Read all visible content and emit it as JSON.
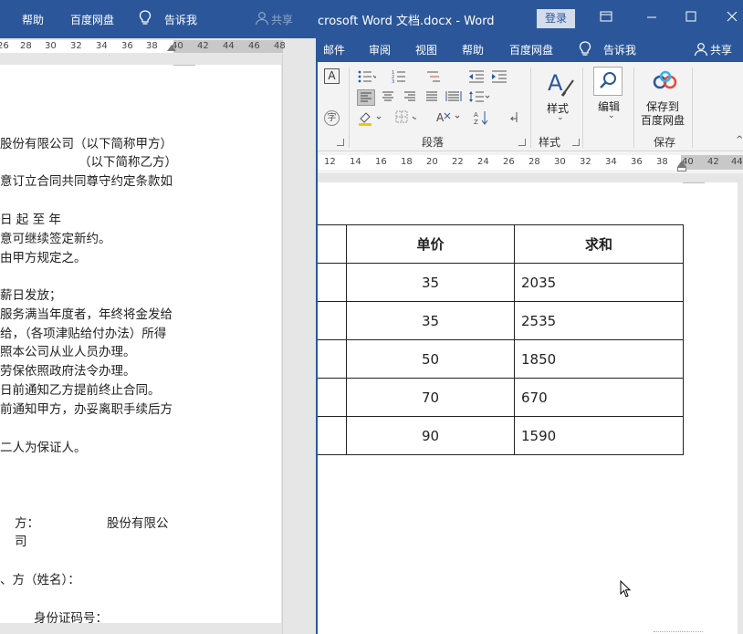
{
  "left_window": {
    "tabs": [
      {
        "label": "帮助"
      },
      {
        "label": "百度网盘"
      },
      {
        "label": "告诉我"
      },
      {
        "label": "共享"
      }
    ],
    "ruler_numbers": [
      "26",
      "28",
      "30",
      "32",
      "34",
      "36",
      "38",
      "40",
      "42",
      "44",
      "46",
      "48"
    ],
    "doc_lines": [
      "股份有限公司（以下简称甲方）",
      "（以下简称乙方）",
      "意订立合同共同尊守约定条款如",
      "日    起    至                              年",
      "意可继续签定新约。",
      "由甲方规定之。",
      "薪日发放；",
      "服务满当年度者，年终将金发给",
      "给，（各项津贴给付办法）所得",
      "照本公司从业人员办理。",
      "劳保依照政府法令办理。",
      "日前通知乙方提前终止合同。",
      "前通知甲方，办妥离职手续后方",
      "二人为保证人。",
      "方：",
      "股份有限公",
      "司",
      "、方（姓名）：",
      "身份证码号："
    ]
  },
  "right_window": {
    "title": "crosoft Word 文档.docx  -  Word",
    "login_label": "登录",
    "tabs": [
      {
        "label": "邮件"
      },
      {
        "label": "审阅"
      },
      {
        "label": "视图"
      },
      {
        "label": "帮助"
      },
      {
        "label": "百度网盘"
      },
      {
        "label": "告诉我"
      },
      {
        "label": "共享"
      }
    ],
    "ribbon": {
      "group_paragraph_label": "段落",
      "group_styles_label": "样式",
      "group_save_label": "保存",
      "styles_button_label": "样式",
      "edit_button_label": "编辑",
      "save_to_baidu_label_line1": "保存到",
      "save_to_baidu_label_line2": "百度网盘"
    },
    "ruler_numbers": [
      "12",
      "14",
      "16",
      "18",
      "20",
      "22",
      "24",
      "26",
      "28",
      "30",
      "32",
      "34",
      "36",
      "38",
      "40",
      "42",
      "44"
    ],
    "table": {
      "headers": [
        "单价",
        "求和"
      ],
      "rows": [
        {
          "price": "35",
          "sum": "2035"
        },
        {
          "price": "35",
          "sum": "2535"
        },
        {
          "price": "50",
          "sum": "1850"
        },
        {
          "price": "70",
          "sum": "670"
        },
        {
          "price": "90",
          "sum": "1590"
        }
      ]
    }
  },
  "colors": {
    "ribbon_blue": "#2b579a",
    "ribbon_bg": "#f3f3f3",
    "workspace_gray": "#e6e6e6"
  },
  "icons": [
    "lightbulb-icon",
    "person-icon",
    "restore-icon",
    "minimize-icon",
    "maximize-icon",
    "close-icon",
    "mouse-cursor-icon"
  ]
}
